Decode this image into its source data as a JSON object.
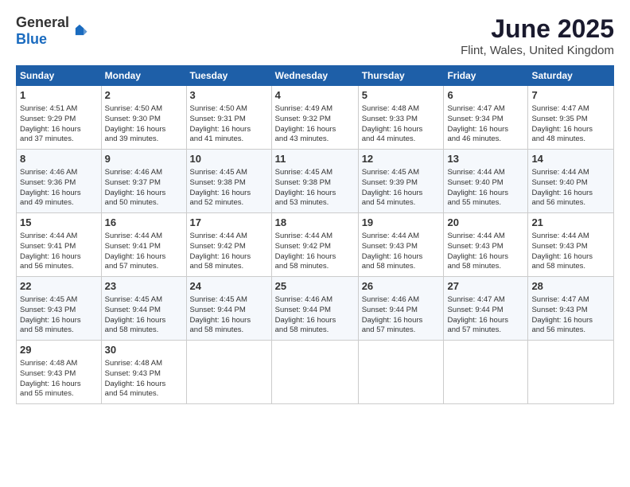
{
  "header": {
    "logo_general": "General",
    "logo_blue": "Blue",
    "month": "June 2025",
    "location": "Flint, Wales, United Kingdom"
  },
  "weekdays": [
    "Sunday",
    "Monday",
    "Tuesday",
    "Wednesday",
    "Thursday",
    "Friday",
    "Saturday"
  ],
  "weeks": [
    [
      {
        "day": "1",
        "info": "Sunrise: 4:51 AM\nSunset: 9:29 PM\nDaylight: 16 hours\nand 37 minutes."
      },
      {
        "day": "2",
        "info": "Sunrise: 4:50 AM\nSunset: 9:30 PM\nDaylight: 16 hours\nand 39 minutes."
      },
      {
        "day": "3",
        "info": "Sunrise: 4:50 AM\nSunset: 9:31 PM\nDaylight: 16 hours\nand 41 minutes."
      },
      {
        "day": "4",
        "info": "Sunrise: 4:49 AM\nSunset: 9:32 PM\nDaylight: 16 hours\nand 43 minutes."
      },
      {
        "day": "5",
        "info": "Sunrise: 4:48 AM\nSunset: 9:33 PM\nDaylight: 16 hours\nand 44 minutes."
      },
      {
        "day": "6",
        "info": "Sunrise: 4:47 AM\nSunset: 9:34 PM\nDaylight: 16 hours\nand 46 minutes."
      },
      {
        "day": "7",
        "info": "Sunrise: 4:47 AM\nSunset: 9:35 PM\nDaylight: 16 hours\nand 48 minutes."
      }
    ],
    [
      {
        "day": "8",
        "info": "Sunrise: 4:46 AM\nSunset: 9:36 PM\nDaylight: 16 hours\nand 49 minutes."
      },
      {
        "day": "9",
        "info": "Sunrise: 4:46 AM\nSunset: 9:37 PM\nDaylight: 16 hours\nand 50 minutes."
      },
      {
        "day": "10",
        "info": "Sunrise: 4:45 AM\nSunset: 9:38 PM\nDaylight: 16 hours\nand 52 minutes."
      },
      {
        "day": "11",
        "info": "Sunrise: 4:45 AM\nSunset: 9:38 PM\nDaylight: 16 hours\nand 53 minutes."
      },
      {
        "day": "12",
        "info": "Sunrise: 4:45 AM\nSunset: 9:39 PM\nDaylight: 16 hours\nand 54 minutes."
      },
      {
        "day": "13",
        "info": "Sunrise: 4:44 AM\nSunset: 9:40 PM\nDaylight: 16 hours\nand 55 minutes."
      },
      {
        "day": "14",
        "info": "Sunrise: 4:44 AM\nSunset: 9:40 PM\nDaylight: 16 hours\nand 56 minutes."
      }
    ],
    [
      {
        "day": "15",
        "info": "Sunrise: 4:44 AM\nSunset: 9:41 PM\nDaylight: 16 hours\nand 56 minutes."
      },
      {
        "day": "16",
        "info": "Sunrise: 4:44 AM\nSunset: 9:41 PM\nDaylight: 16 hours\nand 57 minutes."
      },
      {
        "day": "17",
        "info": "Sunrise: 4:44 AM\nSunset: 9:42 PM\nDaylight: 16 hours\nand 58 minutes."
      },
      {
        "day": "18",
        "info": "Sunrise: 4:44 AM\nSunset: 9:42 PM\nDaylight: 16 hours\nand 58 minutes."
      },
      {
        "day": "19",
        "info": "Sunrise: 4:44 AM\nSunset: 9:43 PM\nDaylight: 16 hours\nand 58 minutes."
      },
      {
        "day": "20",
        "info": "Sunrise: 4:44 AM\nSunset: 9:43 PM\nDaylight: 16 hours\nand 58 minutes."
      },
      {
        "day": "21",
        "info": "Sunrise: 4:44 AM\nSunset: 9:43 PM\nDaylight: 16 hours\nand 58 minutes."
      }
    ],
    [
      {
        "day": "22",
        "info": "Sunrise: 4:45 AM\nSunset: 9:43 PM\nDaylight: 16 hours\nand 58 minutes."
      },
      {
        "day": "23",
        "info": "Sunrise: 4:45 AM\nSunset: 9:44 PM\nDaylight: 16 hours\nand 58 minutes."
      },
      {
        "day": "24",
        "info": "Sunrise: 4:45 AM\nSunset: 9:44 PM\nDaylight: 16 hours\nand 58 minutes."
      },
      {
        "day": "25",
        "info": "Sunrise: 4:46 AM\nSunset: 9:44 PM\nDaylight: 16 hours\nand 58 minutes."
      },
      {
        "day": "26",
        "info": "Sunrise: 4:46 AM\nSunset: 9:44 PM\nDaylight: 16 hours\nand 57 minutes."
      },
      {
        "day": "27",
        "info": "Sunrise: 4:47 AM\nSunset: 9:44 PM\nDaylight: 16 hours\nand 57 minutes."
      },
      {
        "day": "28",
        "info": "Sunrise: 4:47 AM\nSunset: 9:43 PM\nDaylight: 16 hours\nand 56 minutes."
      }
    ],
    [
      {
        "day": "29",
        "info": "Sunrise: 4:48 AM\nSunset: 9:43 PM\nDaylight: 16 hours\nand 55 minutes."
      },
      {
        "day": "30",
        "info": "Sunrise: 4:48 AM\nSunset: 9:43 PM\nDaylight: 16 hours\nand 54 minutes."
      },
      null,
      null,
      null,
      null,
      null
    ]
  ]
}
